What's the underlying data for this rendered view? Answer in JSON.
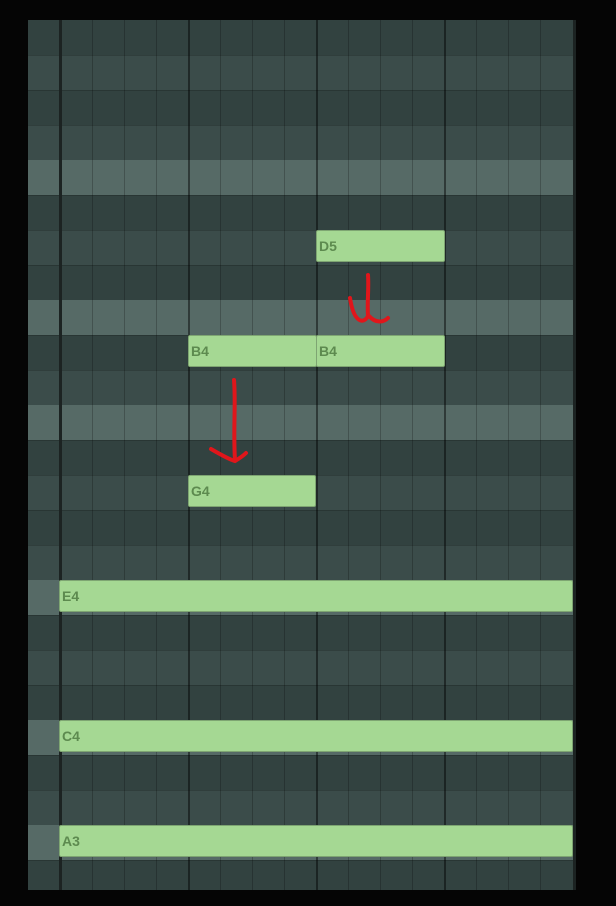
{
  "piano_roll": {
    "notes": [
      {
        "label": "D5"
      },
      {
        "label": "B4"
      },
      {
        "label": "B4"
      },
      {
        "label": "G4"
      },
      {
        "label": "E4"
      },
      {
        "label": "C4"
      },
      {
        "label": "A3"
      }
    ],
    "note_color": "#a5d893",
    "grid_color": "#3a4b49",
    "highlight_row_color": "#566a66"
  },
  "annotations": {
    "arrow_color": "#e0161b"
  }
}
